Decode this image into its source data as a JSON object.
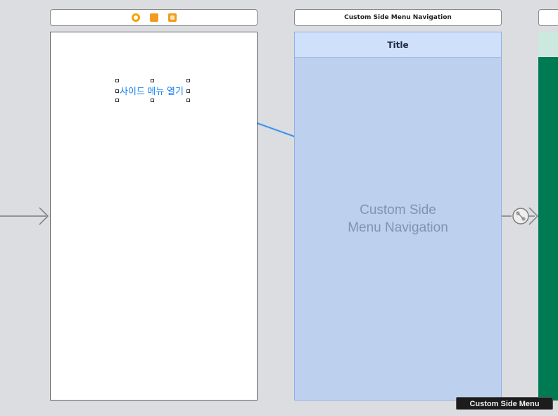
{
  "scenes": [
    {
      "title": "",
      "dock_icons": [
        "view-controller-icon",
        "first-responder-icon",
        "exit-icon"
      ],
      "button_label": "사이드 메뉴 열기"
    },
    {
      "title": "Custom Side Menu Navigation",
      "nav_title": "Title",
      "placeholder": "Custom Side\nMenu Navigation"
    }
  ],
  "tooltip": "Custom Side Menu",
  "colors": {
    "canvas": "#dcdde0",
    "accent_blue": "#1a82f3",
    "nav_scene_fill": "#bdd1ee",
    "nav_bar_fill": "#cfe0fb",
    "green_scene": "#007a53"
  }
}
